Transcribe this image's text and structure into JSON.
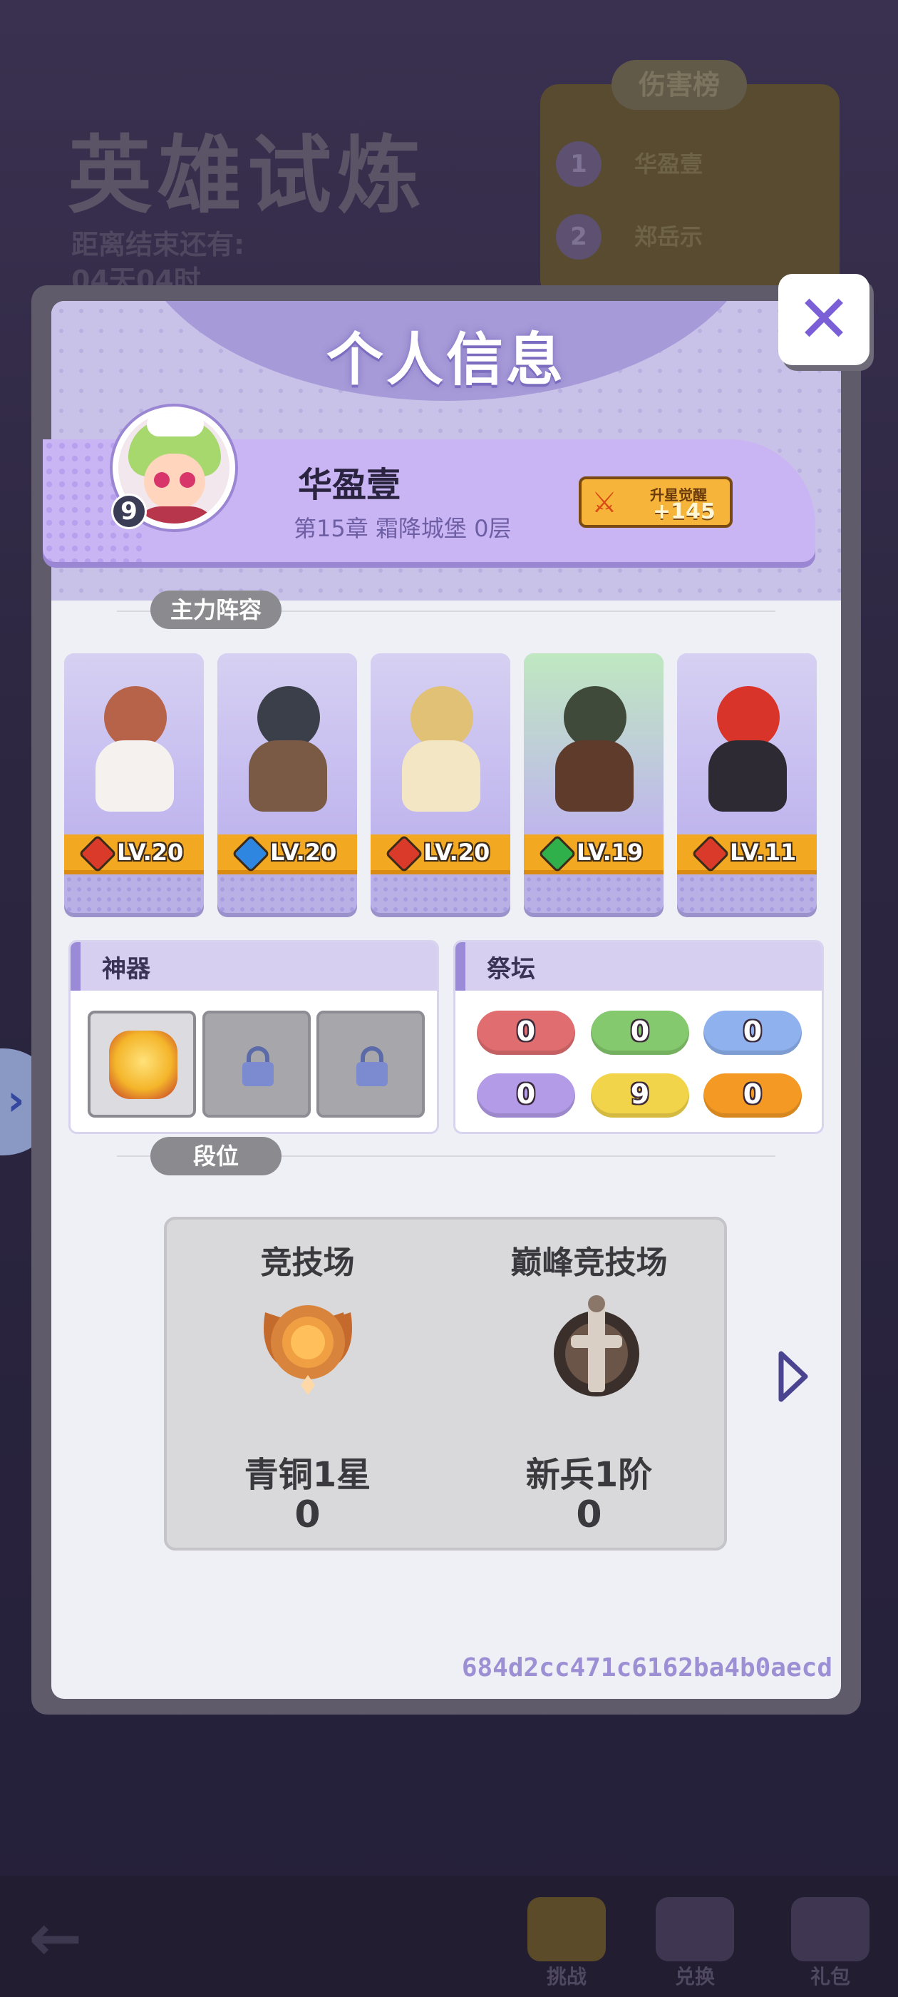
{
  "background": {
    "event_title": "英雄试炼",
    "countdown_label": "距离结束还有:",
    "countdown_value": "04天04时",
    "damage_rank_title": "伤害榜",
    "rank_rows": [
      {
        "rank": "1",
        "name": "华盈壹"
      },
      {
        "rank": "2",
        "name": "郑岳示"
      }
    ],
    "nav": {
      "challenge": "挑战",
      "exchange": "兑换",
      "gift": "礼包"
    }
  },
  "modal": {
    "title": "个人信息",
    "close_icon": "close-icon",
    "profile": {
      "avatar_level": "9",
      "name": "华盈壹",
      "progress": "第15章 霜降城堡 0层",
      "awaken_label": "升星觉醒",
      "awaken_value": "+145"
    },
    "lineup": {
      "title": "主力阵容",
      "heroes": [
        {
          "level": "LV.20",
          "element": "fire",
          "gem_color": "#d93a2a",
          "char_color": "#b7634a"
        },
        {
          "level": "LV.20",
          "element": "water",
          "gem_color": "#2f86e0",
          "char_color": "#3b3f4a"
        },
        {
          "level": "LV.20",
          "element": "fire",
          "gem_color": "#d93a2a",
          "char_color": "#e0c176"
        },
        {
          "level": "LV.19",
          "element": "nature",
          "gem_color": "#2fb04a",
          "char_color": "#3f4a3a"
        },
        {
          "level": "LV.11",
          "element": "fire",
          "gem_color": "#d93a2a",
          "char_color": "#d9342a"
        }
      ]
    },
    "artifacts": {
      "title": "神器",
      "slots": [
        "filled",
        "locked",
        "locked"
      ]
    },
    "altar": {
      "title": "祭坛",
      "values": [
        {
          "value": "0",
          "color": "#e06e70"
        },
        {
          "value": "0",
          "color": "#84c96e"
        },
        {
          "value": "0",
          "color": "#8fb2ee"
        },
        {
          "value": "0",
          "color": "#b39be8"
        },
        {
          "value": "9",
          "color": "#f2d44a"
        },
        {
          "value": "0",
          "color": "#f49a24"
        }
      ]
    },
    "ranks": {
      "title": "段位",
      "items": [
        {
          "arena": "竞技场",
          "tier": "青铜1星",
          "score": "0"
        },
        {
          "arena": "巅峰竞技场",
          "tier": "新兵1阶",
          "score": "0"
        }
      ]
    },
    "uid": "684d2cc471c6162ba4b0aecd"
  }
}
